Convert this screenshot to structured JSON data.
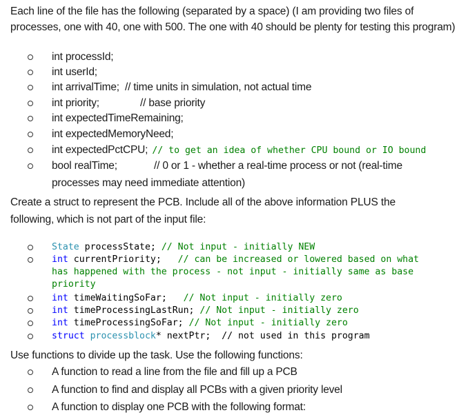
{
  "intro": "Each line of the file has the following (separated by a space) (I am providing two files of processes, one with 40, one with 500. The one with 40 should be plenty for testing this program)",
  "input_fields": [
    {
      "decl": "int processId;",
      "comment": ""
    },
    {
      "decl": "int userId;",
      "comment": ""
    },
    {
      "decl": "int arrivalTime;",
      "comment": "// time units in simulation, not actual time"
    },
    {
      "decl": "int priority;",
      "comment": "// base priority"
    },
    {
      "decl": "int expectedTimeRemaining;",
      "comment": ""
    },
    {
      "decl": "int expectedMemoryNeed;",
      "comment": ""
    },
    {
      "decl": "int expectedPctCPU;",
      "comment": "// to get an idea of whether CPU bound or IO bound"
    },
    {
      "decl": "bool realTime;",
      "comment": "// 0 or 1 - whether a real-time process or not (real-time",
      "continuation": "processes may need immediate attention)"
    }
  ],
  "struct_paragraph": {
    "line1": "Create a struct to represent the PCB.  Include all of the above information PLUS the",
    "line2": "following, which is not part of the input file:"
  },
  "extra_fields": [
    {
      "type": "State",
      "name": "processState;",
      "comment": "// Not input - initially NEW"
    },
    {
      "type": "int",
      "name": "currentPriority;",
      "comment": "// can be increased or lowered based on what",
      "continuation": [
        "has happened with the process - not input - initially same as base",
        "priority"
      ]
    },
    {
      "type": "int",
      "name": "timeWaitingSoFar;",
      "comment": "// Not input - initially zero"
    },
    {
      "type": "int",
      "name": "timeProcessingLastRun;",
      "comment": "// Not input - initially zero"
    },
    {
      "type": "int",
      "name": "timeProcessingSoFar;",
      "comment": "// Not input - initially zero"
    },
    {
      "type": "struct",
      "type2": "processblock",
      "name": "* nextPtr;",
      "comment": "// not used in this program"
    }
  ],
  "functions_paragraph": "Use functions to divide up the task.  Use the following functions:",
  "functions": [
    "A function to read a line from the file and fill up a PCB",
    "A function to find and display all PCBs with a given priority level",
    "A function to display one PCB with the following format:"
  ],
  "colors": {
    "keyword": "#0000ff",
    "type": "#2b91af",
    "comment": "#008000",
    "text": "#1a1a1a"
  }
}
